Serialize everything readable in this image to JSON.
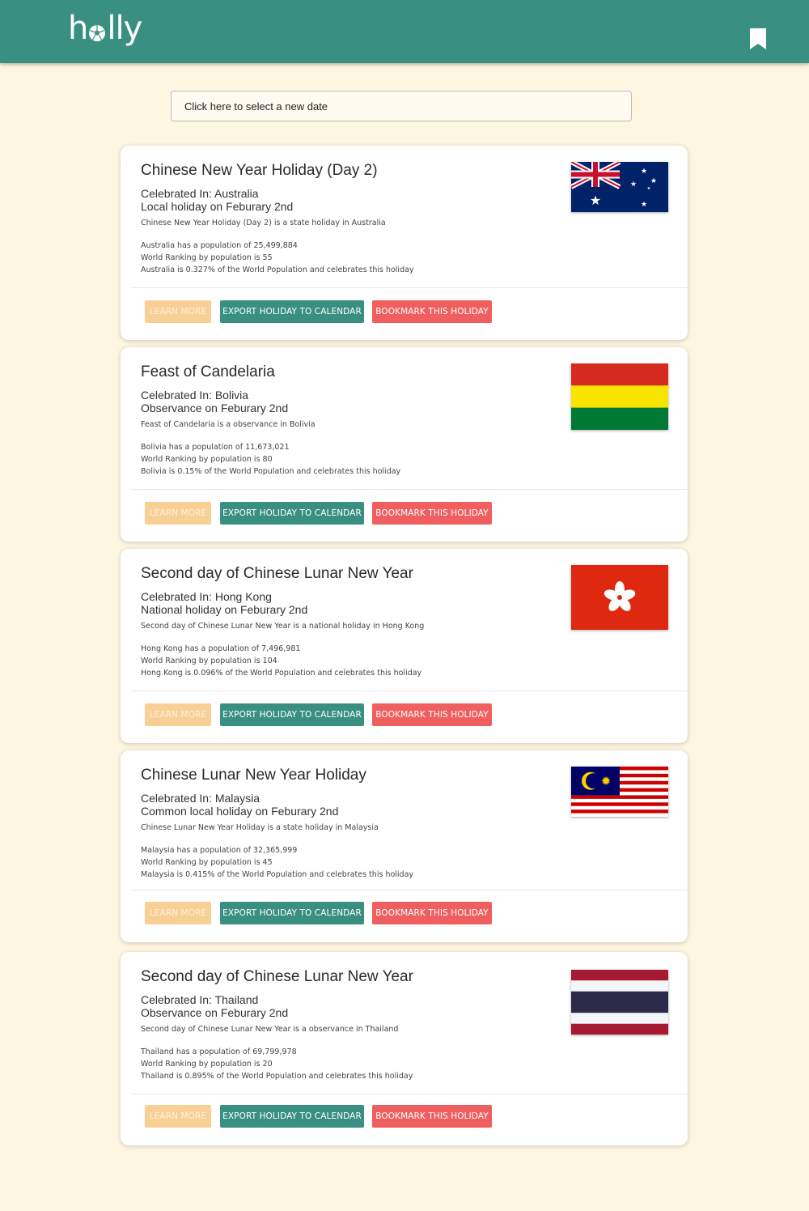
{
  "header": {
    "logo_text_left": "h",
    "logo_text_right": "lly",
    "bookmark_icon": "bookmark-icon",
    "color": "#3a9080"
  },
  "date_picker": {
    "label": "Click here to select a new date"
  },
  "buttons": {
    "learn_more": "LEARN MORE",
    "export": "EXPORT HOLIDAY TO CALENDAR",
    "bookmark": "BOOKMARK THIS HOLIDAY"
  },
  "holidays": [
    {
      "title": "Chinese New Year Holiday (Day 2)",
      "celebrated": "Celebrated In: Australia",
      "type_date": "Local holiday on Feburary 2nd",
      "description": "Chinese New Year Holiday (Day 2) is a state holiday in Australia",
      "population": "Australia has a population of 25,499,884",
      "ranking": "World Ranking by population is 55",
      "percent": "Australia is 0.327% of the World Population and celebrates this holiday",
      "flag": "australia-flag"
    },
    {
      "title": "Feast of Candelaria",
      "celebrated": "Celebrated In: Bolivia",
      "type_date": "Observance on Feburary 2nd",
      "description": "Feast of Candelaria is a observance in Bolivia",
      "population": "Bolivia has a population of 11,673,021",
      "ranking": "World Ranking by population is 80",
      "percent": "Bolivia is 0.15% of the World Population and celebrates this holiday",
      "flag": "bolivia-flag"
    },
    {
      "title": "Second day of Chinese Lunar New Year",
      "celebrated": "Celebrated In: Hong Kong",
      "type_date": "National holiday on Feburary 2nd",
      "description": "Second day of Chinese Lunar New Year is a national holiday in Hong Kong",
      "population": "Hong Kong has a population of 7,496,981",
      "ranking": "World Ranking by population is 104",
      "percent": "Hong Kong is 0.096% of the World Population and celebrates this holiday",
      "flag": "hong-kong-flag"
    },
    {
      "title": "Chinese Lunar New Year Holiday",
      "celebrated": "Celebrated In: Malaysia",
      "type_date": "Common local holiday on Feburary 2nd",
      "description": "Chinese Lunar New Year Holiday is a state holiday in Malaysia",
      "population": "Malaysia has a population of 32,365,999",
      "ranking": "World Ranking by population is 45",
      "percent": "Malaysia is 0.415% of the World Population and celebrates this holiday",
      "flag": "malaysia-flag"
    },
    {
      "title": "Second day of Chinese Lunar New Year",
      "celebrated": "Celebrated In: Thailand",
      "type_date": "Observance on Feburary 2nd",
      "description": "Second day of Chinese Lunar New Year is a observance in Thailand",
      "population": "Thailand has a population of 69,799,978",
      "ranking": "World Ranking by population is 20",
      "percent": "Thailand is 0.895% of the World Population and celebrates this holiday",
      "flag": "thailand-flag"
    }
  ]
}
